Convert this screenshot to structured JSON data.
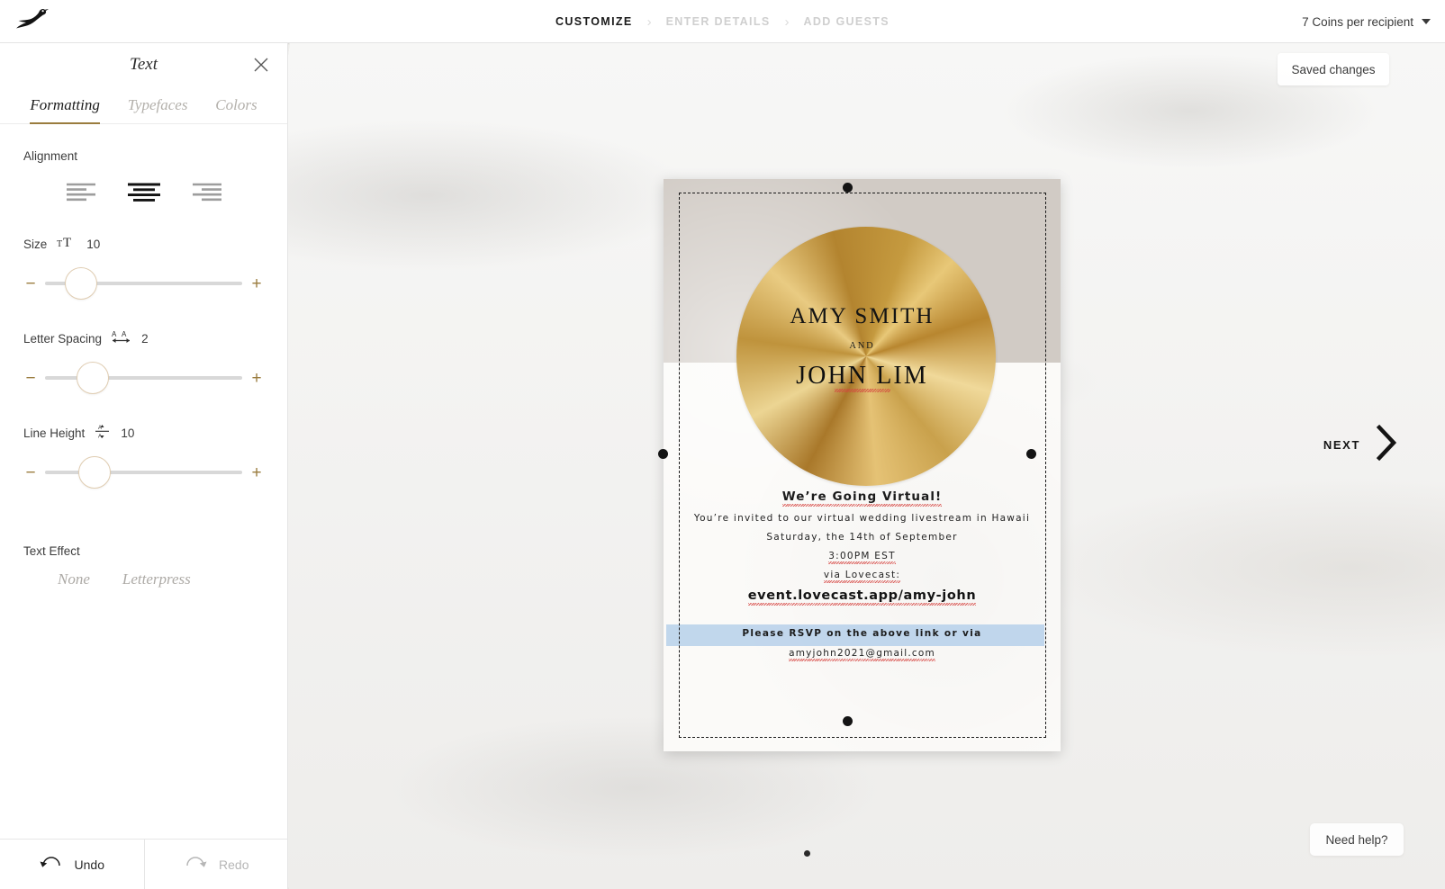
{
  "header": {
    "logo_icon": "bird-logo-icon",
    "steps": [
      {
        "label": "CUSTOMIZE",
        "active": true
      },
      {
        "label": "ENTER DETAILS",
        "active": false
      },
      {
        "label": "ADD GUESTS",
        "active": false
      }
    ],
    "separator": "›",
    "coins_label": "7 Coins per recipient"
  },
  "panel": {
    "title": "Text",
    "close_icon": "close-icon",
    "tabs": [
      {
        "label": "Formatting",
        "active": true
      },
      {
        "label": "Typefaces",
        "active": false
      },
      {
        "label": "Colors",
        "active": false
      }
    ],
    "alignment": {
      "label": "Alignment",
      "options": [
        {
          "name": "align-left",
          "selected": false
        },
        {
          "name": "align-center",
          "selected": true
        },
        {
          "name": "align-right",
          "selected": false
        }
      ]
    },
    "size": {
      "label": "Size",
      "icon": "font-size-icon",
      "value": "10",
      "minus": "−",
      "plus": "+",
      "knob_percent": 10
    },
    "letter_spacing": {
      "label": "Letter Spacing",
      "icon": "letter-spacing-icon",
      "value": "2",
      "minus": "−",
      "plus": "+",
      "knob_percent": 16
    },
    "line_height": {
      "label": "Line Height",
      "icon": "line-height-icon",
      "value": "10",
      "minus": "−",
      "plus": "+",
      "knob_percent": 17
    },
    "text_effect": {
      "label": "Text Effect",
      "options": [
        {
          "label": "None",
          "selected": false
        },
        {
          "label": "Letterpress",
          "selected": false
        }
      ]
    },
    "footer": {
      "undo_label": "Undo",
      "undo_icon": "undo-arrow-icon",
      "redo_label": "Redo",
      "redo_icon": "redo-arrow-icon"
    }
  },
  "canvas": {
    "saved_label": "Saved changes",
    "next_label": "NEXT",
    "next_icon": "chevron-right-icon",
    "help_label": "Need help?"
  },
  "card": {
    "names": {
      "first": "AMY SMITH",
      "conjunction": "AND",
      "second": "JOHN LIM"
    },
    "body": {
      "headline": "We’re Going Virtual!",
      "line1": "You’re invited to our virtual wedding livestream in Hawaii",
      "line2": "Saturday, the 14th of September",
      "line3": "3:00PM EST",
      "line4": "via Lovecast:",
      "url": "event.lovecast.app/amy-john"
    },
    "rsvp": {
      "line1": "Please RSVP on the above link or via",
      "line2": "amyjohn2021@gmail.com"
    },
    "colors": {
      "top_band": "#d1cbc5",
      "paper": "#fbfaf8",
      "gold": "#c59a3f",
      "selection_highlight": "#b6d0ea"
    }
  }
}
